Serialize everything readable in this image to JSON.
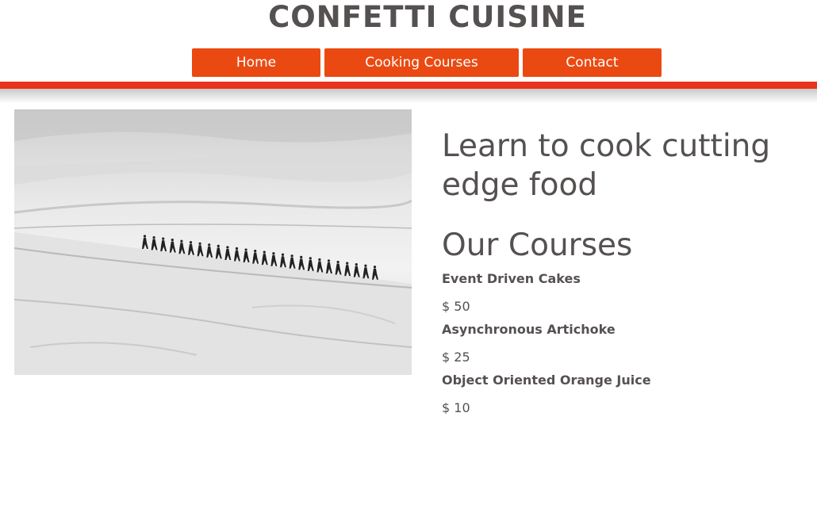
{
  "header": {
    "site_title": "CONFETTI CUISINE",
    "nav": [
      {
        "label": "Home"
      },
      {
        "label": "Cooking Courses"
      },
      {
        "label": "Contact"
      }
    ],
    "accent_color": "#ea4a12",
    "stripe_color": "#e8341c"
  },
  "main": {
    "hero_image_icon": "snowfield-hikers-photo",
    "hero_title": "Learn to cook cutting edge food",
    "courses_title": "Our Courses",
    "courses": [
      {
        "name": "Event Driven Cakes",
        "price": "$ 50"
      },
      {
        "name": "Asynchronous Artichoke",
        "price": "$ 25"
      },
      {
        "name": "Object Oriented Orange Juice",
        "price": "$ 10"
      }
    ]
  }
}
